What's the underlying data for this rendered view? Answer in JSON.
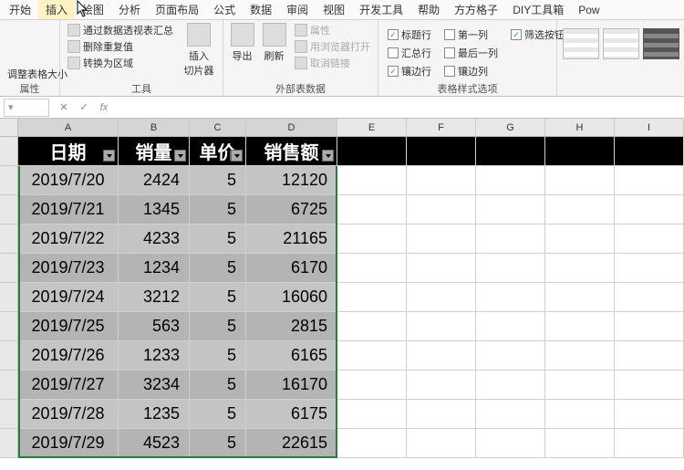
{
  "menu": {
    "tabs": [
      "开始",
      "插入",
      "绘图",
      "分析",
      "页面布局",
      "公式",
      "数据",
      "审阅",
      "视图",
      "开发工具",
      "帮助",
      "方方格子",
      "DIY工具箱",
      "Pow"
    ]
  },
  "ribbon": {
    "group1": {
      "label": "属性",
      "item1": "调整表格大小"
    },
    "group2": {
      "label": "工具",
      "item1": "通过数据透视表汇总",
      "item2": "删除重复值",
      "item3": "转换为区域",
      "btn": "插入\n切片器"
    },
    "group3": {
      "label": "外部表数据",
      "btn1": "导出",
      "btn2": "刷新",
      "item1": "属性",
      "item2": "用浏览器打开",
      "item3": "取消链接"
    },
    "group4": {
      "label": "表格样式选项",
      "c11": "标题行",
      "c12": "第一列",
      "c13": "筛选按钮",
      "c21": "汇总行",
      "c22": "最后一列",
      "c31": "镶边行",
      "c32": "镶边列"
    }
  },
  "columns": [
    "A",
    "B",
    "C",
    "D",
    "E",
    "F",
    "G",
    "H",
    "I"
  ],
  "table": {
    "headers": [
      "日期",
      "销量",
      "单价",
      "销售额"
    ],
    "rows": [
      {
        "date": "2019/7/20",
        "qty": "2424",
        "price": "5",
        "total": "12120"
      },
      {
        "date": "2019/7/21",
        "qty": "1345",
        "price": "5",
        "total": "6725"
      },
      {
        "date": "2019/7/22",
        "qty": "4233",
        "price": "5",
        "total": "21165"
      },
      {
        "date": "2019/7/23",
        "qty": "1234",
        "price": "5",
        "total": "6170"
      },
      {
        "date": "2019/7/24",
        "qty": "3212",
        "price": "5",
        "total": "16060"
      },
      {
        "date": "2019/7/25",
        "qty": "563",
        "price": "5",
        "total": "2815"
      },
      {
        "date": "2019/7/26",
        "qty": "1233",
        "price": "5",
        "total": "6165"
      },
      {
        "date": "2019/7/27",
        "qty": "3234",
        "price": "5",
        "total": "16170"
      },
      {
        "date": "2019/7/28",
        "qty": "1235",
        "price": "5",
        "total": "6175"
      },
      {
        "date": "2019/7/29",
        "qty": "4523",
        "price": "5",
        "total": "22615"
      }
    ]
  },
  "checks": {
    "c11": true,
    "c12": false,
    "c13": true,
    "c21": false,
    "c22": false,
    "c31": true,
    "c32": false
  }
}
